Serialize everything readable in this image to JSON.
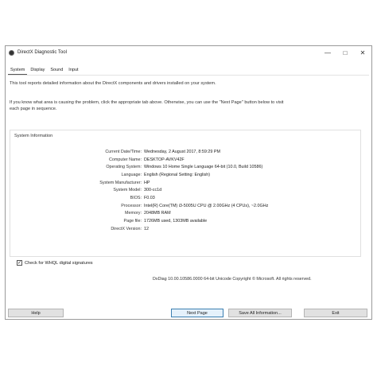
{
  "window": {
    "title": "DirectX Diagnostic Tool",
    "controls": [
      "—",
      "□",
      "✕"
    ]
  },
  "tabs": [
    {
      "label": "System",
      "active": true
    },
    {
      "label": "Display",
      "active": false
    },
    {
      "label": "Sound",
      "active": false
    },
    {
      "label": "Input",
      "active": false
    }
  ],
  "intro": {
    "line1": "This tool reports detailed information about the DirectX components and drivers installed on your system.",
    "line2a": "If you know what area is causing the problem, click the appropriate tab above.  Otherwise, you can use the \"Next Page\" button below to visit",
    "line2b": "each page in sequence."
  },
  "system_info": {
    "legend": "System Information",
    "rows": [
      {
        "label": "Current Date/Time:",
        "value": "Wednesday, 2 August 2017, 8:59:29 PM"
      },
      {
        "label": "Computer Name:",
        "value": "DESKTOP-AVKV42F"
      },
      {
        "label": "Operating System:",
        "value": "Windows 10 Home Single Language 64-bit (10.0, Build 10586)"
      },
      {
        "label": "Language:",
        "value": "English (Regional Setting: English)"
      },
      {
        "label": "System Manufacturer:",
        "value": "HP"
      },
      {
        "label": "System Model:",
        "value": "300-cc1d"
      },
      {
        "label": "BIOS:",
        "value": "F0.03"
      },
      {
        "label": "Processor:",
        "value": "Intel(R) Core(TM) i3-5005U CPU @ 2.00GHz (4 CPUs), ~2.0GHz"
      },
      {
        "label": "Memory:",
        "value": "2048MB RAM"
      },
      {
        "label": "Page file:",
        "value": "1726MB used, 1303MB available"
      },
      {
        "label": "DirectX Version:",
        "value": "12"
      }
    ]
  },
  "whql_check": {
    "label": "Check for WHQL digital signatures",
    "checked": true,
    "mark": "✓"
  },
  "footer": "DxDiag 10.00.10586.0000 64-bit Unicode  Copyright © Microsoft. All rights reserved.",
  "buttons": {
    "help": "Help",
    "next": "Next Page",
    "save": "Save All Information...",
    "exit": "Exit"
  }
}
